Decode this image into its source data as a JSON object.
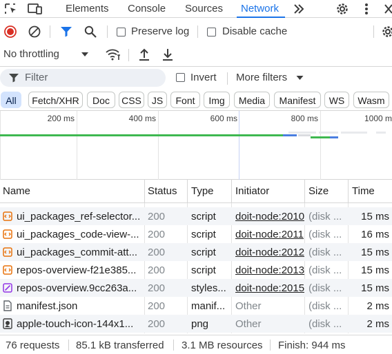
{
  "tabs": [
    "Elements",
    "Console",
    "Sources",
    "Network"
  ],
  "active_tab": "Network",
  "toolbar": {
    "preserve_log": "Preserve log",
    "disable_cache": "Disable cache",
    "throttling": "No throttling"
  },
  "filter": {
    "placeholder": "Filter",
    "invert": "Invert",
    "more_filters": "More filters"
  },
  "type_filters": [
    "All",
    "Fetch/XHR",
    "Doc",
    "CSS",
    "JS",
    "Font",
    "Img",
    "Media",
    "Manifest",
    "WS",
    "Wasm"
  ],
  "active_type_filter": "All",
  "overview": {
    "ticks": [
      "200 ms",
      "400 ms",
      "600 ms",
      "800 ms",
      "1000 m"
    ]
  },
  "columns": [
    "Name",
    "Status",
    "Type",
    "Initiator",
    "Size",
    "Time"
  ],
  "rows": [
    {
      "name": "ui_packages_ref-selector...",
      "status": "200",
      "type": "script",
      "initiator": "doit-node:2010",
      "size": "(disk ...",
      "time": "15 ms",
      "icon": "script-icon"
    },
    {
      "name": "ui_packages_code-view-...",
      "status": "200",
      "type": "script",
      "initiator": "doit-node:2011",
      "size": "(disk ...",
      "time": "16 ms",
      "icon": "script-icon"
    },
    {
      "name": "ui_packages_commit-att...",
      "status": "200",
      "type": "script",
      "initiator": "doit-node:2012",
      "size": "(disk ...",
      "time": "15 ms",
      "icon": "script-icon"
    },
    {
      "name": "repos-overview-f21e385...",
      "status": "200",
      "type": "script",
      "initiator": "doit-node:2013",
      "size": "(disk ...",
      "time": "15 ms",
      "icon": "script-icon"
    },
    {
      "name": "repos-overview.9cc263a...",
      "status": "200",
      "type": "styles...",
      "initiator": "doit-node:2015",
      "size": "(disk ...",
      "time": "15 ms",
      "icon": "stylesheet-icon"
    },
    {
      "name": "manifest.json",
      "status": "200",
      "type": "manif...",
      "initiator": "Other",
      "size": "(disk ...",
      "time": "2 ms",
      "icon": "document-icon"
    },
    {
      "name": "apple-touch-icon-144x1...",
      "status": "200",
      "type": "png",
      "initiator": "Other",
      "size": "(disk ...",
      "time": "2 ms",
      "icon": "image-icon"
    }
  ],
  "status_bar": {
    "requests": "76 requests",
    "transferred": "85.1 kB transferred",
    "resources": "3.1 MB resources",
    "finish": "Finish: 944 ms"
  },
  "colors": {
    "accent": "#1a73e8",
    "record": "#d93025",
    "script_icon": "#e8710a",
    "stylesheet_icon": "#9334e6"
  }
}
